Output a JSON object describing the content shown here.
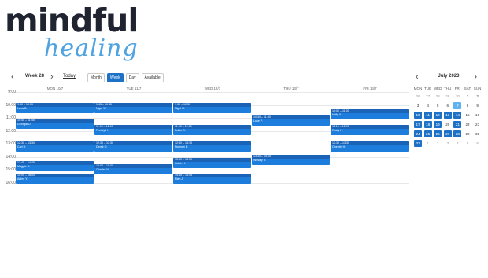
{
  "brand": {
    "main": "mindful",
    "script": "healing"
  },
  "toolbar": {
    "prev": "‹",
    "next": "›",
    "week_label": "Week 28",
    "today_label": "Today",
    "views": [
      {
        "label": "Month",
        "active": false
      },
      {
        "label": "Week",
        "active": true
      },
      {
        "label": "Day",
        "active": false
      },
      {
        "label": "Available",
        "active": false
      }
    ]
  },
  "calendar": {
    "days": [
      "MON 10/7",
      "TUE 11/7",
      "WED 12/7",
      "THU 13/7",
      "FRI 14/7"
    ],
    "hours": [
      "9:00",
      "10:00",
      "11:00",
      "12:00",
      "13:00",
      "14:00",
      "15:00",
      "16:00"
    ],
    "events": [
      {
        "day": 0,
        "start": 10.0,
        "time": "9:30 – 10:30",
        "name": "Lena B."
      },
      {
        "day": 0,
        "start": 11.25,
        "time": "10:45 – 11:45",
        "name": "Georgia O."
      },
      {
        "day": 0,
        "start": 13.0,
        "time": "12:30 – 13:30",
        "name": "Carl H."
      },
      {
        "day": 0,
        "start": 14.5,
        "time": "13:45 – 14:45",
        "name": "Maggie C."
      },
      {
        "day": 0,
        "start": 15.5,
        "time": "15:00 – 16:00",
        "name": "Aiden Y."
      },
      {
        "day": 1,
        "start": 10.0,
        "time": "9:45 – 10:45",
        "name": "Nigel W."
      },
      {
        "day": 1,
        "start": 11.75,
        "time": "11:00 – 12:00",
        "name": "Freddy H."
      },
      {
        "day": 1,
        "start": 13.0,
        "time": "12:30 – 13:30",
        "name": "Derek O."
      },
      {
        "day": 1,
        "start": 14.75,
        "time": "14:00 – 15:00",
        "name": "Charles W."
      },
      {
        "day": 2,
        "start": 10.0,
        "time": "9:30 – 10:30",
        "name": "Nigel H."
      },
      {
        "day": 2,
        "start": 11.75,
        "time": "11:00 – 12:00",
        "name": "Pablo B."
      },
      {
        "day": 2,
        "start": 13.0,
        "time": "12:30 – 13:15",
        "name": "Norman B."
      },
      {
        "day": 2,
        "start": 14.25,
        "time": "13:30 – 14:30",
        "name": "Caleb H."
      },
      {
        "day": 2,
        "start": 15.5,
        "time": "14:45 – 15:45",
        "name": "Rian J."
      },
      {
        "day": 3,
        "start": 11.0,
        "time": "10:30 – 11:30",
        "name": "Luke P."
      },
      {
        "day": 3,
        "start": 14.0,
        "time": "13:30 – 14:15",
        "name": "Wesley R."
      },
      {
        "day": 4,
        "start": 10.5,
        "time": "10:00 – 11:00",
        "name": "Holly Y."
      },
      {
        "day": 4,
        "start": 11.75,
        "time": "11:15 – 12:00",
        "name": "Rusty H."
      },
      {
        "day": 4,
        "start": 13.0,
        "time": "12:30 – 13:30",
        "name": "Quentin H."
      }
    ]
  },
  "minical": {
    "title": "July 2023",
    "prev": "‹",
    "next": "›",
    "dow": [
      "MON",
      "TUE",
      "WED",
      "THU",
      "FRI",
      "SAT",
      "SUN"
    ],
    "weeks": [
      [
        [
          "26",
          "muted"
        ],
        [
          "27",
          "muted"
        ],
        [
          "28",
          "muted"
        ],
        [
          "29",
          "muted"
        ],
        [
          "30",
          "muted"
        ],
        [
          "1",
          "normal"
        ],
        [
          "2",
          "normal"
        ]
      ],
      [
        [
          "3",
          "normal"
        ],
        [
          "4",
          "normal"
        ],
        [
          "5",
          "normal"
        ],
        [
          "6",
          "normal"
        ],
        [
          "7",
          "today"
        ],
        [
          "8",
          "normal"
        ],
        [
          "9",
          "normal"
        ]
      ],
      [
        [
          "10",
          "avail"
        ],
        [
          "11",
          "avail"
        ],
        [
          "12",
          "avail"
        ],
        [
          "13",
          "avail"
        ],
        [
          "14",
          "avail"
        ],
        [
          "15",
          "normal"
        ],
        [
          "16",
          "normal"
        ]
      ],
      [
        [
          "17",
          "avail"
        ],
        [
          "18",
          "avail"
        ],
        [
          "19",
          "avail"
        ],
        [
          "20",
          "normal"
        ],
        [
          "21",
          "avail"
        ],
        [
          "22",
          "normal"
        ],
        [
          "23",
          "normal"
        ]
      ],
      [
        [
          "24",
          "avail"
        ],
        [
          "25",
          "avail"
        ],
        [
          "26",
          "avail"
        ],
        [
          "27",
          "avail"
        ],
        [
          "28",
          "avail"
        ],
        [
          "29",
          "normal"
        ],
        [
          "30",
          "normal"
        ]
      ],
      [
        [
          "31",
          "avail"
        ],
        [
          "1",
          "muted"
        ],
        [
          "2",
          "muted"
        ],
        [
          "3",
          "muted"
        ],
        [
          "4",
          "muted"
        ],
        [
          "5",
          "muted"
        ],
        [
          "6",
          "muted"
        ]
      ]
    ]
  }
}
